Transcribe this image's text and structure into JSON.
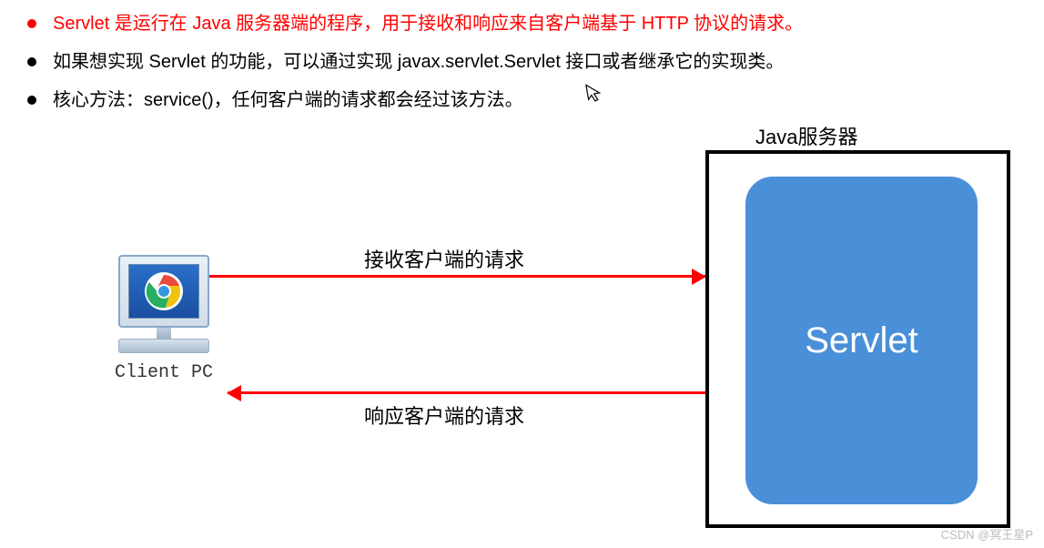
{
  "bullets": [
    {
      "text": "Servlet 是运行在 Java 服务器端的程序，用于接收和响应来自客户端基于 HTTP 协议的请求。",
      "color": "red"
    },
    {
      "text": "如果想实现 Servlet 的功能，可以通过实现 javax.servlet.Servlet 接口或者继承它的实现类。",
      "color": "black"
    },
    {
      "text": "核心方法：service()，任何客户端的请求都会经过该方法。",
      "color": "black"
    }
  ],
  "diagram": {
    "client_label": "Client PC",
    "client_icon": "chrome-icon",
    "server_label": "Java服务器",
    "servlet_label": "Servlet",
    "arrow_request_label": "接收客户端的请求",
    "arrow_response_label": "响应客户端的请求"
  },
  "watermark": "CSDN @冥王星P"
}
